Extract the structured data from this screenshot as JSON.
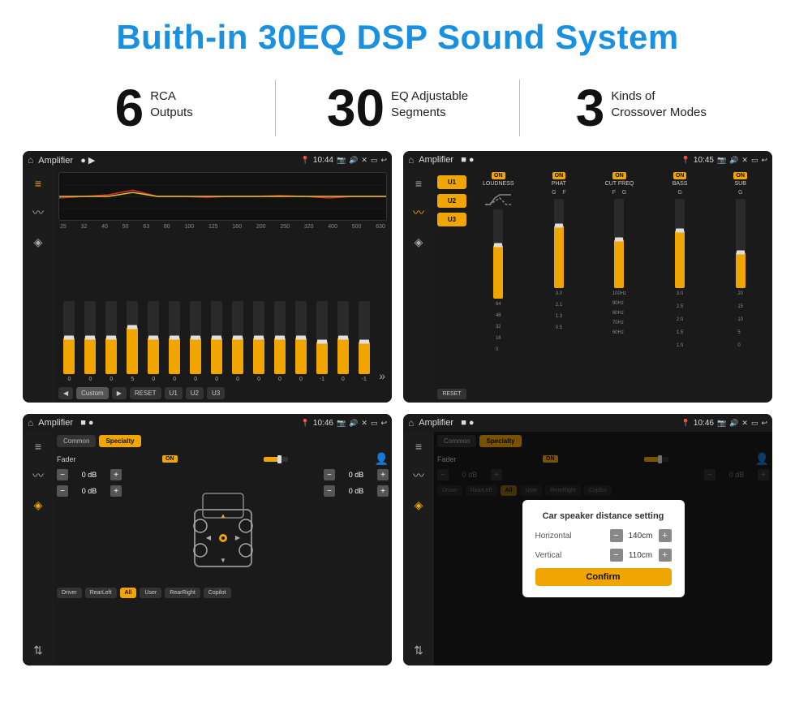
{
  "page": {
    "title": "Buith-in 30EQ DSP Sound System",
    "features": [
      {
        "number": "6",
        "text": "RCA\nOutputs"
      },
      {
        "number": "30",
        "text": "EQ Adjustable\nSegments"
      },
      {
        "number": "3",
        "text": "Kinds of\nCrossover Modes"
      }
    ]
  },
  "screens": [
    {
      "id": "eq-screen",
      "statusbar": {
        "app": "Amplifier",
        "time": "10:44"
      },
      "type": "eq",
      "eq_labels": [
        "25",
        "32",
        "40",
        "50",
        "63",
        "80",
        "100",
        "125",
        "160",
        "200",
        "250",
        "320",
        "400",
        "500",
        "630"
      ],
      "eq_values": [
        0,
        0,
        0,
        5,
        0,
        0,
        0,
        0,
        0,
        0,
        0,
        0,
        -1,
        0,
        -1
      ],
      "bottom_buttons": [
        "Custom",
        "RESET",
        "U1",
        "U2",
        "U3"
      ]
    },
    {
      "id": "crossover-screen",
      "statusbar": {
        "app": "Amplifier",
        "time": "10:45"
      },
      "type": "crossover",
      "presets": [
        "U1",
        "U2",
        "U3"
      ],
      "channels": [
        {
          "on": true,
          "name": "LOUDNESS"
        },
        {
          "on": true,
          "name": "PHAT"
        },
        {
          "on": true,
          "name": "CUT FREQ"
        },
        {
          "on": true,
          "name": "BASS"
        },
        {
          "on": true,
          "name": "SUB"
        }
      ]
    },
    {
      "id": "fader-screen",
      "statusbar": {
        "app": "Amplifier",
        "time": "10:46"
      },
      "type": "fader",
      "tabs": [
        "Common",
        "Specialty"
      ],
      "active_tab": "Specialty",
      "fader_label": "Fader",
      "fader_on": true,
      "controls_left": [
        "0 dB",
        "0 dB"
      ],
      "controls_right": [
        "0 dB",
        "0 dB"
      ],
      "bottom_buttons": [
        "Driver",
        "RearLeft",
        "All",
        "User",
        "RearRight",
        "Copilot"
      ]
    },
    {
      "id": "dialog-screen",
      "statusbar": {
        "app": "Amplifier",
        "time": "10:46"
      },
      "type": "fader-dialog",
      "tabs": [
        "Common",
        "Specialty"
      ],
      "active_tab": "Specialty",
      "dialog": {
        "title": "Car speaker distance setting",
        "horizontal_label": "Horizontal",
        "horizontal_value": "140cm",
        "vertical_label": "Vertical",
        "vertical_value": "110cm",
        "confirm_label": "Confirm"
      },
      "controls_left_right": [
        "0 dB",
        "0 dB"
      ],
      "bottom_buttons": [
        "Driver",
        "RearLeft",
        "All",
        "User",
        "RearRight",
        "Copilot"
      ]
    }
  ]
}
